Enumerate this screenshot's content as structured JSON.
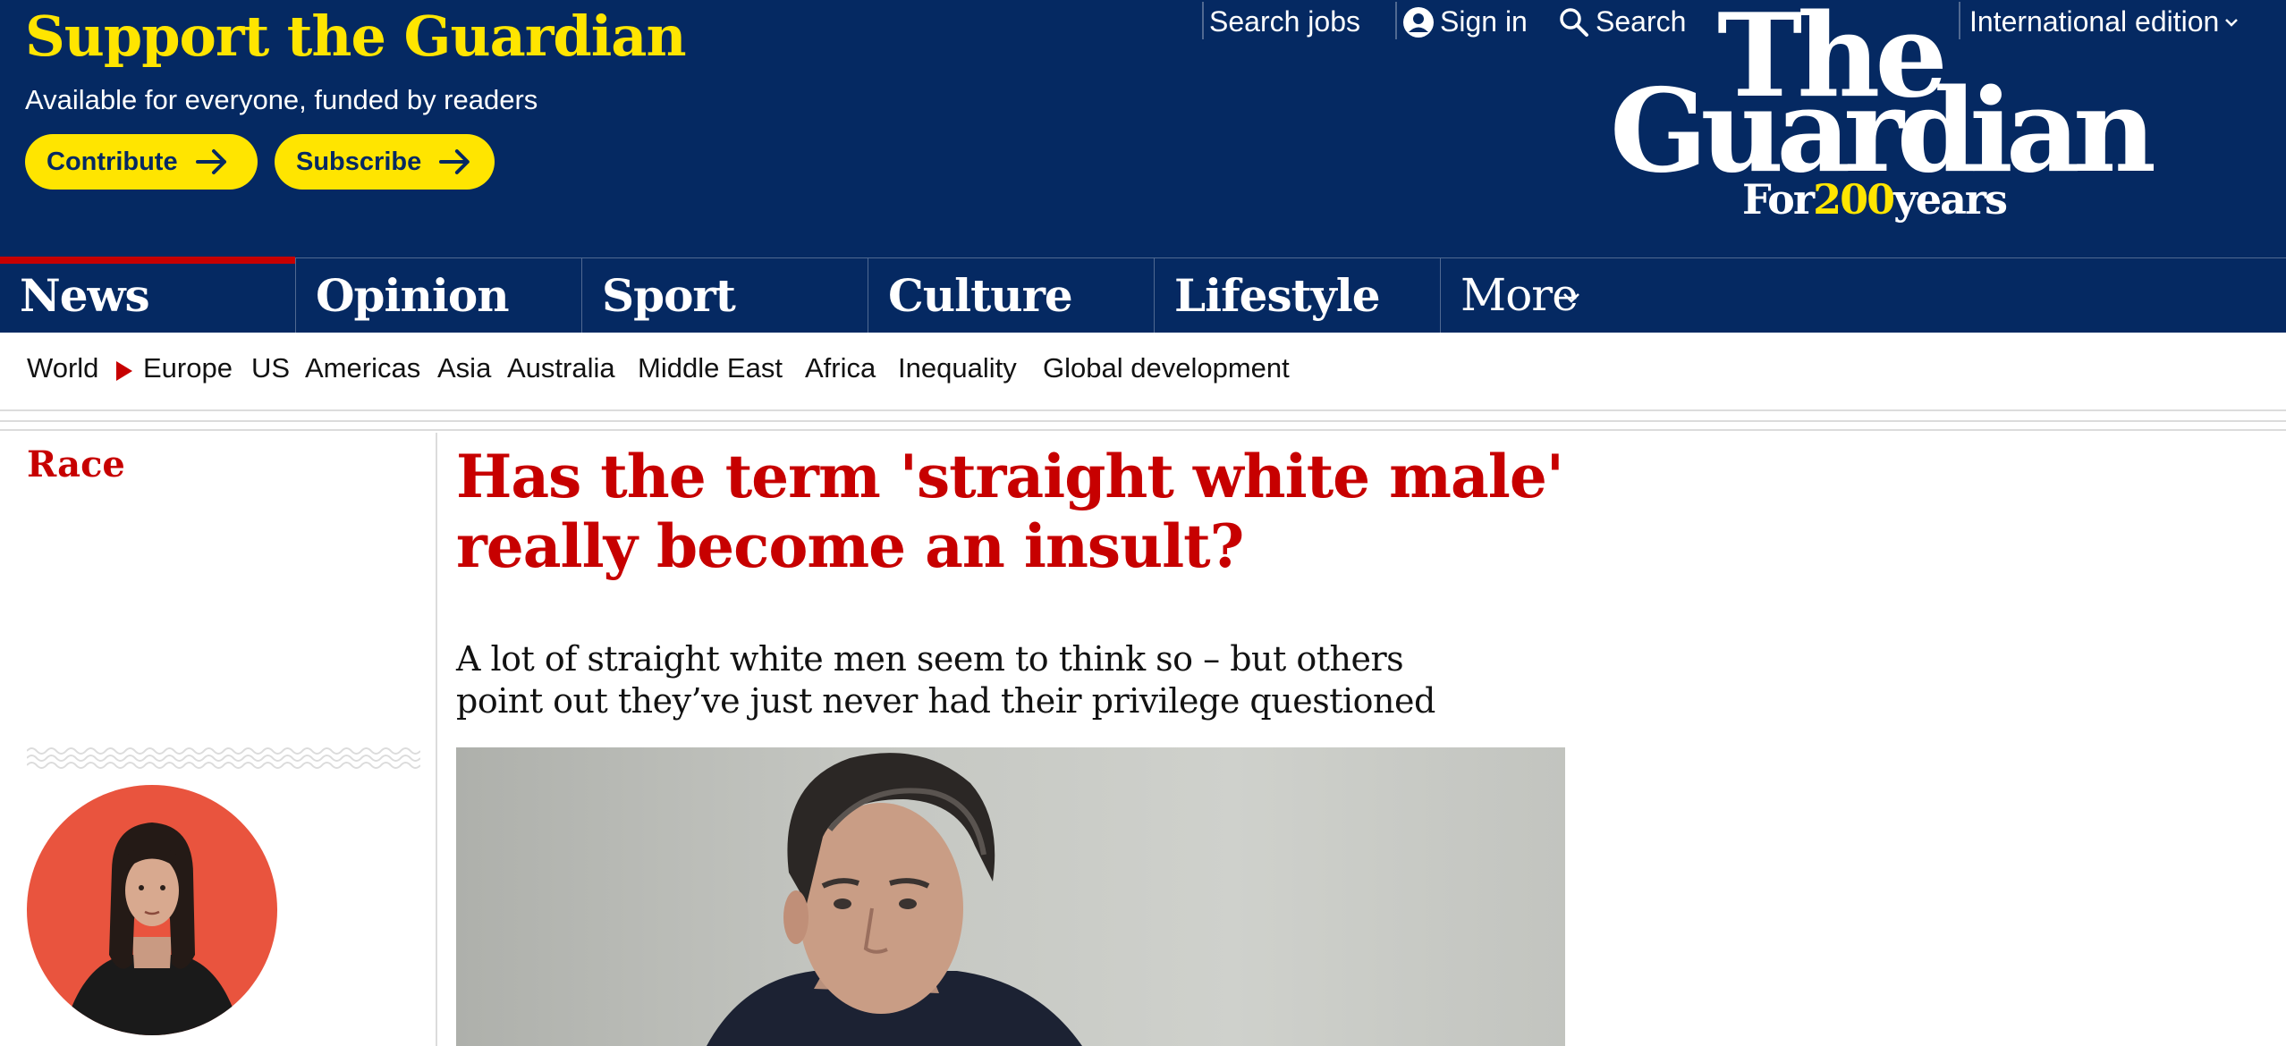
{
  "support": {
    "title": "Support the Guardian",
    "subtitle": "Available for everyone, funded by readers",
    "contribute_label": "Contribute",
    "subscribe_label": "Subscribe"
  },
  "top_links": {
    "search_jobs": "Search jobs",
    "sign_in": "Sign in",
    "search": "Search",
    "edition": "International edition"
  },
  "logo": {
    "the": "The",
    "guardian": "Guardian",
    "for": "For",
    "years_num": "200",
    "years": "years"
  },
  "nav": {
    "items": [
      {
        "label": "News"
      },
      {
        "label": "Opinion"
      },
      {
        "label": "Sport"
      },
      {
        "label": "Culture"
      },
      {
        "label": "Lifestyle"
      },
      {
        "label": "More"
      }
    ]
  },
  "subnav": {
    "items": [
      {
        "label": "World"
      },
      {
        "label": "Europe"
      },
      {
        "label": "US"
      },
      {
        "label": "Americas"
      },
      {
        "label": "Asia"
      },
      {
        "label": "Australia"
      },
      {
        "label": "Middle East"
      },
      {
        "label": "Africa"
      },
      {
        "label": "Inequality"
      },
      {
        "label": "Global development"
      }
    ]
  },
  "article": {
    "section": "Race",
    "headline": "Has the term 'straight white male' really become an insult?",
    "standfirst": "A lot of straight white men seem to think so – but others point out they’ve just never had their privilege questioned"
  },
  "colors": {
    "brand": "#052962",
    "accent_yellow": "#ffe500",
    "news_red": "#c70000",
    "avatar_bg": "#e9543e"
  }
}
